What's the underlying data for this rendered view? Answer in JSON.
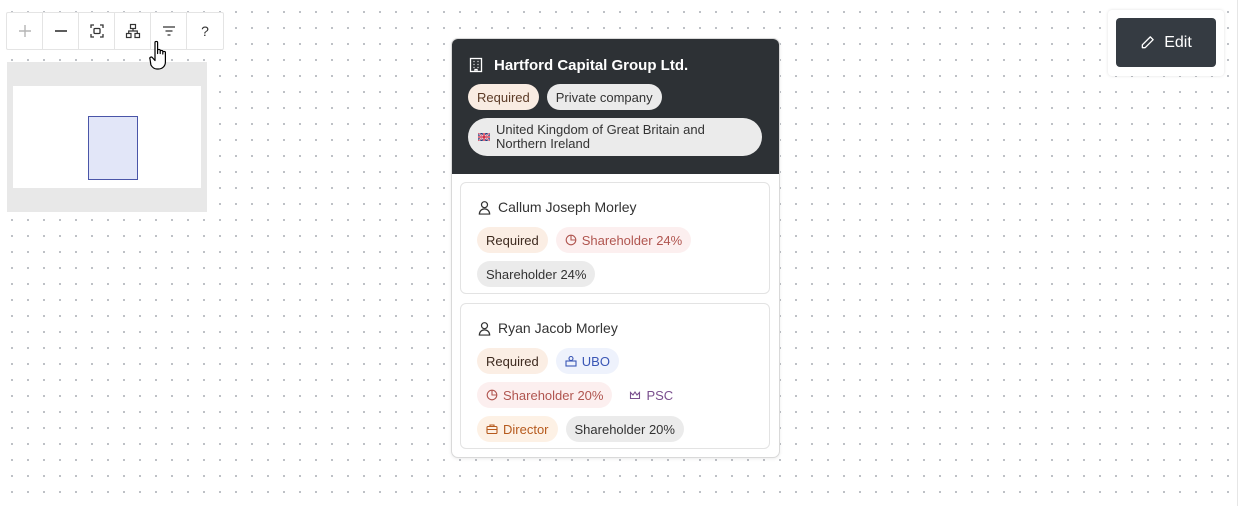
{
  "toolbar": {
    "buttons": [
      {
        "name": "zoom-in",
        "icon": "plus-icon",
        "enabled": false
      },
      {
        "name": "zoom-out",
        "icon": "minus-icon",
        "enabled": true
      },
      {
        "name": "fit-view",
        "icon": "fit-view-icon",
        "enabled": true
      },
      {
        "name": "layout",
        "icon": "hierarchy-icon",
        "enabled": true
      },
      {
        "name": "filter",
        "icon": "filter-icon",
        "enabled": true
      }
    ],
    "help_label": "?"
  },
  "edit": {
    "label": "Edit",
    "icon": "pencil-icon"
  },
  "company": {
    "name": "Hartford Capital Group Ltd.",
    "icon": "building-icon",
    "badges": {
      "required": "Required",
      "type": "Private company"
    },
    "country": "United Kingdom of Great Britain and Northern Ireland",
    "country_flag": "uk-flag-icon"
  },
  "persons": [
    {
      "name": "Callum Joseph Morley",
      "icon": "user-icon",
      "badges": {
        "required": "Required",
        "shareholder_role": "Shareholder 24%",
        "shareholder": "Shareholder 24%"
      }
    },
    {
      "name": "Ryan Jacob Morley",
      "icon": "user-icon",
      "badges": {
        "required": "Required",
        "ubo": "UBO",
        "shareholder_role": "Shareholder 20%",
        "psc": "PSC",
        "director": "Director",
        "shareholder": "Shareholder 20%"
      }
    }
  ],
  "colors": {
    "header_bg": "#2d3135",
    "edit_bg": "#353b42",
    "required_bg": "#f9ece2",
    "shareholder_red": "#b0554f",
    "ubo_blue": "#3a56b5",
    "psc_purple": "#7a4f8e",
    "director_orange": "#b65a1d"
  }
}
